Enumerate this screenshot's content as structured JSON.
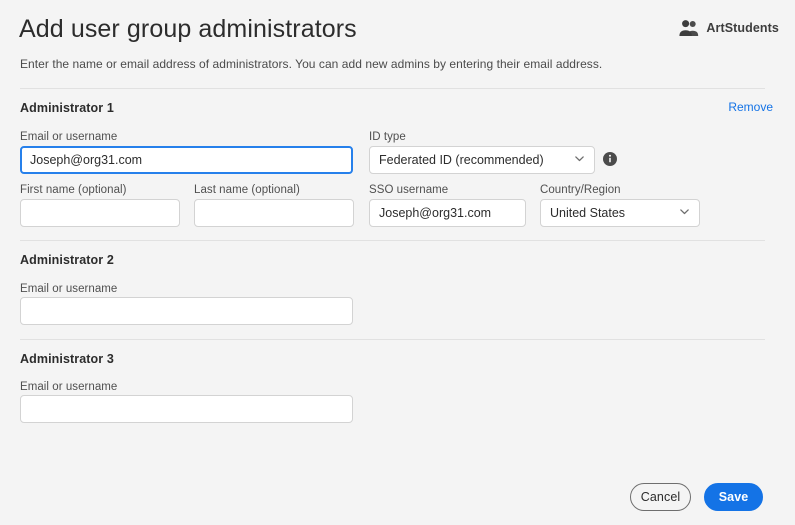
{
  "header": {
    "title": "Add user group administrators",
    "description": "Enter the name or email address of administrators. You can add new admins by entering their email address.",
    "brand_name": "ArtStudents",
    "brand_icon": "user-group-icon"
  },
  "colors": {
    "accent_blue": "#1473e6",
    "focus_blue": "#2680eb",
    "background": "#f4f4f4",
    "divider": "#e1e1e1",
    "input_border": "#d3d3d3",
    "text": "#2c2c2c",
    "label": "#505050"
  },
  "administrators": [
    {
      "section_label": "Administrator 1",
      "remove_label": "Remove",
      "email_label": "Email or username",
      "email_value": "Joseph@org31.com",
      "email_placeholder": "",
      "id_type_label": "ID type",
      "id_type_value": "Federated ID (recommended)",
      "info_icon": "info-icon",
      "first_name_label": "First name (optional)",
      "first_name_value": "",
      "last_name_label": "Last name (optional)",
      "last_name_value": "",
      "sso_username_label": "SSO username",
      "sso_username_value": "Joseph@org31.com",
      "country_label": "Country/Region",
      "country_value": "United States"
    },
    {
      "section_label": "Administrator 2",
      "email_label": "Email or username",
      "email_value": "",
      "email_placeholder": ""
    },
    {
      "section_label": "Administrator 3",
      "email_label": "Email or username",
      "email_value": "",
      "email_placeholder": ""
    }
  ],
  "footer": {
    "cancel_label": "Cancel",
    "save_label": "Save"
  }
}
